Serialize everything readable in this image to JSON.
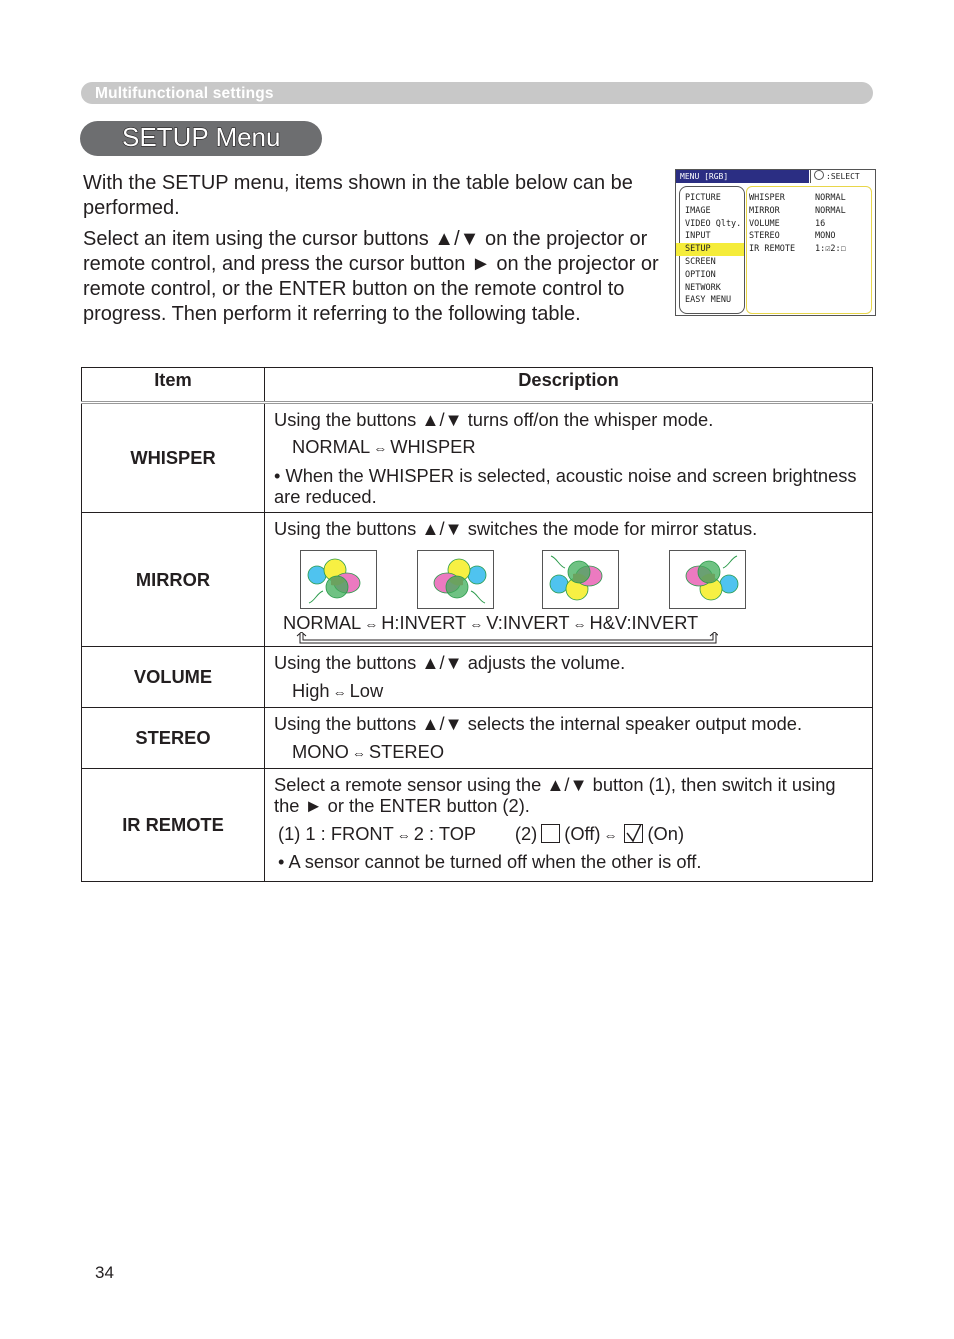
{
  "section_header": "Multifunctional settings",
  "page_title": "SETUP Menu",
  "intro": {
    "para1": "With the SETUP menu, items shown in the table below can be performed.",
    "para2": "Select an item using the cursor buttons ▲/▼ on the projector or remote control, and press the cursor button ► on the projector or remote control, or the ENTER button on the remote control to progress. Then perform it referring to the following table."
  },
  "osd_menu": {
    "title": "MENU [RGB]",
    "select_hint": ":SELECT",
    "left_items": [
      "PICTURE",
      "IMAGE",
      "VIDEO Qlty.",
      "INPUT",
      "SETUP",
      "SCREEN",
      "OPTION",
      "NETWORK",
      "EASY MENU"
    ],
    "selected_index": 4,
    "right_items": [
      {
        "key": "WHISPER",
        "value": "NORMAL"
      },
      {
        "key": "MIRROR",
        "value": "NORMAL"
      },
      {
        "key": "VOLUME",
        "value": "16"
      },
      {
        "key": "STEREO",
        "value": "MONO"
      },
      {
        "key": "IR REMOTE",
        "value": "1:☑2:☐"
      }
    ],
    "colors": {
      "title_bar": "#2b2e83",
      "highlight": "#f5ec3a",
      "panel_border": "#e8d64a"
    }
  },
  "table": {
    "headers": {
      "item": "Item",
      "description": "Description"
    },
    "rows": [
      {
        "item": "WHISPER",
        "line1": "Using the buttons ▲/▼ turns off/on the whisper mode.",
        "options": [
          "NORMAL",
          "WHISPER"
        ],
        "note": "• When the WHISPER is selected, acoustic noise and screen brightness are reduced."
      },
      {
        "item": "MIRROR",
        "line1": "Using the buttons ▲/▼ switches the mode for mirror status.",
        "options": [
          "NORMAL",
          "H:INVERT",
          "V:INVERT",
          "H&V:INVERT"
        ]
      },
      {
        "item": "VOLUME",
        "line1": "Using the buttons ▲/▼ adjusts the volume.",
        "options": [
          "High",
          "Low"
        ]
      },
      {
        "item": "STEREO",
        "line1": "Using the buttons ▲/▼ selects the internal speaker output mode.",
        "options": [
          "MONO",
          "STEREO"
        ]
      },
      {
        "item": "IR REMOTE",
        "line1": "Select a remote sensor using the ▲/▼ button (1), then switch it using the ► or the ENTER button (2).",
        "opt1_prefix": "(1) 1 : FRONT",
        "opt1_second": "2 : TOP",
        "opt2_prefix": "(2)",
        "opt2_off": "(Off)",
        "opt2_on": "(On)",
        "note": "• A sensor cannot be turned off when the other is off."
      }
    ],
    "arrow_symbol": "⇔"
  },
  "page_number": "34"
}
